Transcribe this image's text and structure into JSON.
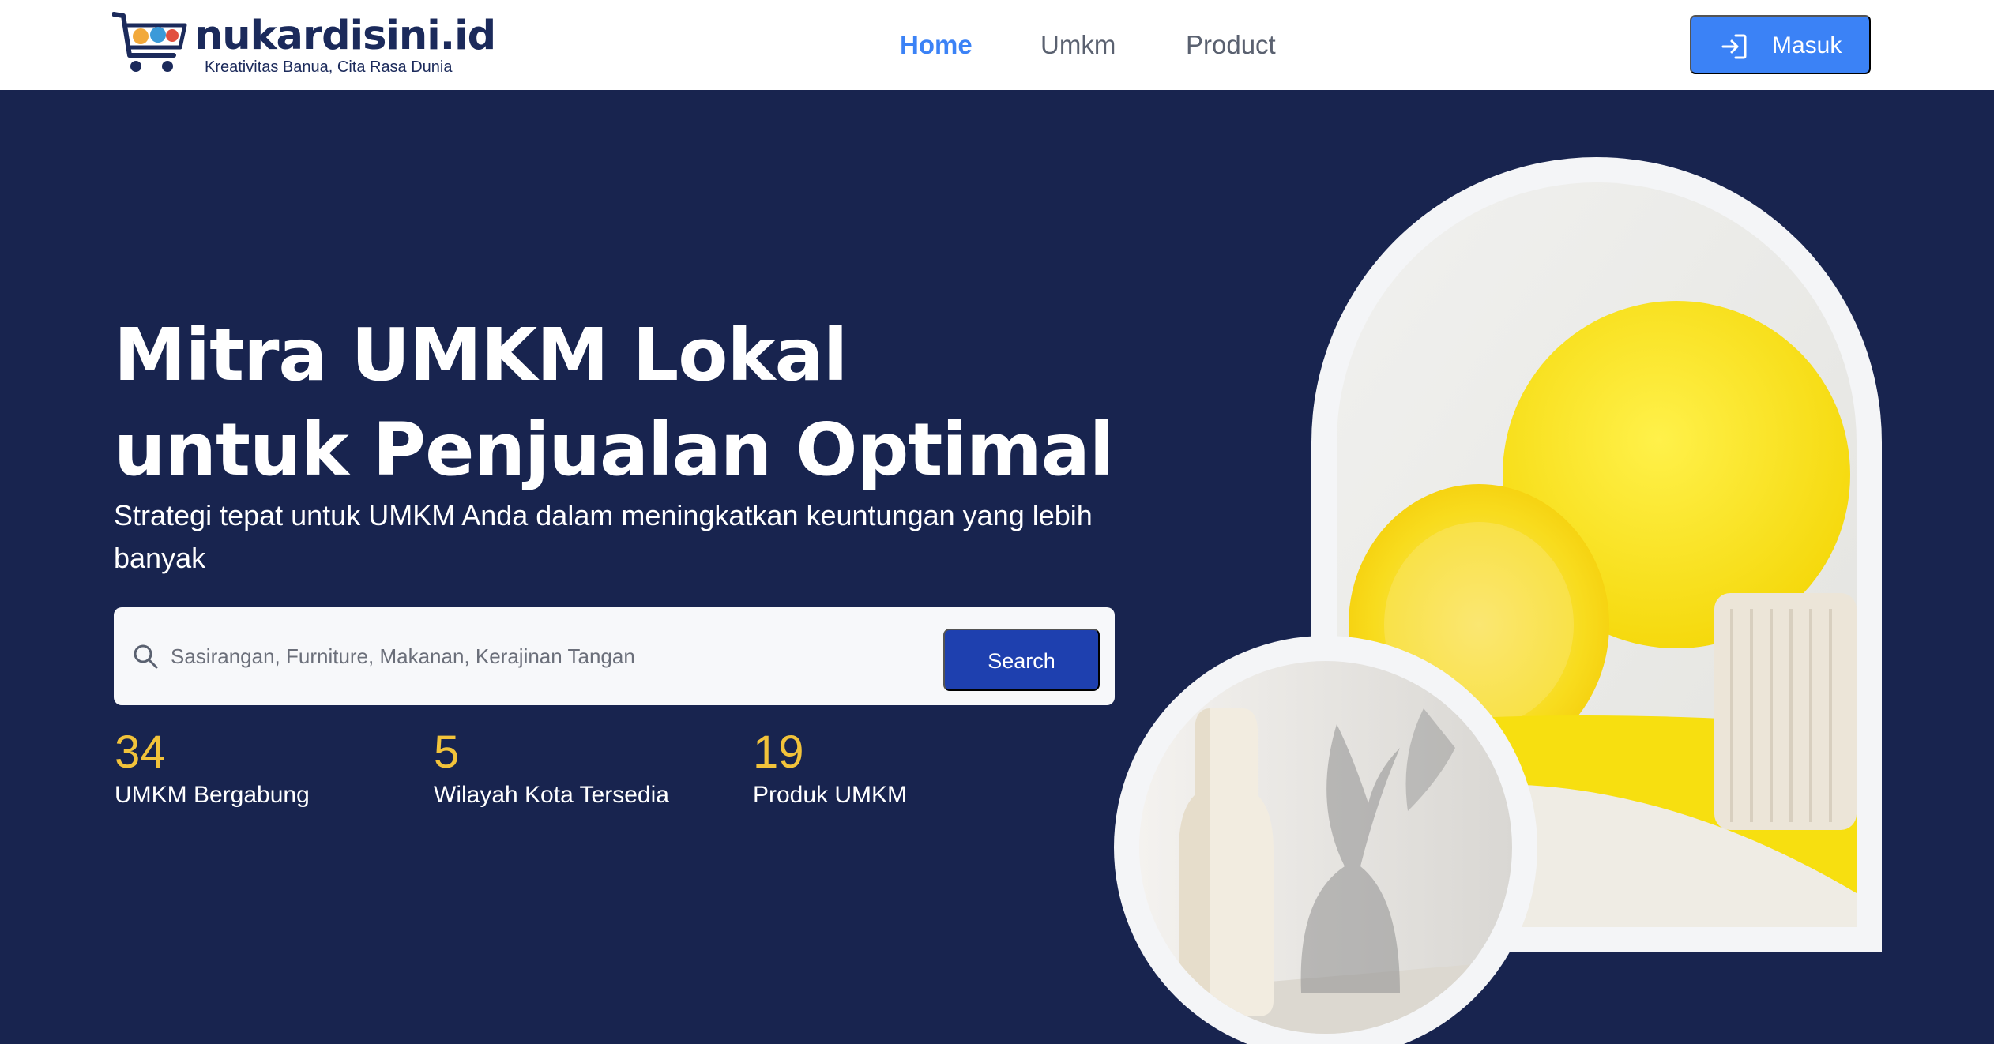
{
  "header": {
    "logo": {
      "title": "nukardisini.id",
      "tagline": "Kreativitas Banua, Cita Rasa Dunia"
    },
    "nav": [
      {
        "label": "Home",
        "active": true
      },
      {
        "label": "Umkm",
        "active": false
      },
      {
        "label": "Product",
        "active": false
      }
    ],
    "login_label": "Masuk"
  },
  "hero": {
    "title_line1": "Mitra UMKM Lokal",
    "title_line2": "untuk Penjualan Optimal",
    "subtitle": "Strategi tepat untuk UMKM Anda dalam meningkatkan keuntungan yang lebih banyak",
    "search": {
      "placeholder": "Sasirangan, Furniture, Makanan, Kerajinan Tangan",
      "value": "",
      "button_label": "Search"
    },
    "stats": [
      {
        "value": "34",
        "label": "UMKM Bergabung"
      },
      {
        "value": "5",
        "label": "Wilayah Kota Tersedia"
      },
      {
        "value": "19",
        "label": "Produk UMKM"
      }
    ]
  },
  "colors": {
    "hero_background": "#18244f",
    "accent_blue": "#3b82f6",
    "search_button": "#1e40af",
    "stat_number": "#f2c33a"
  },
  "icons": {
    "logo": "shopping-cart-icon",
    "login": "login-icon",
    "search": "search-icon"
  }
}
